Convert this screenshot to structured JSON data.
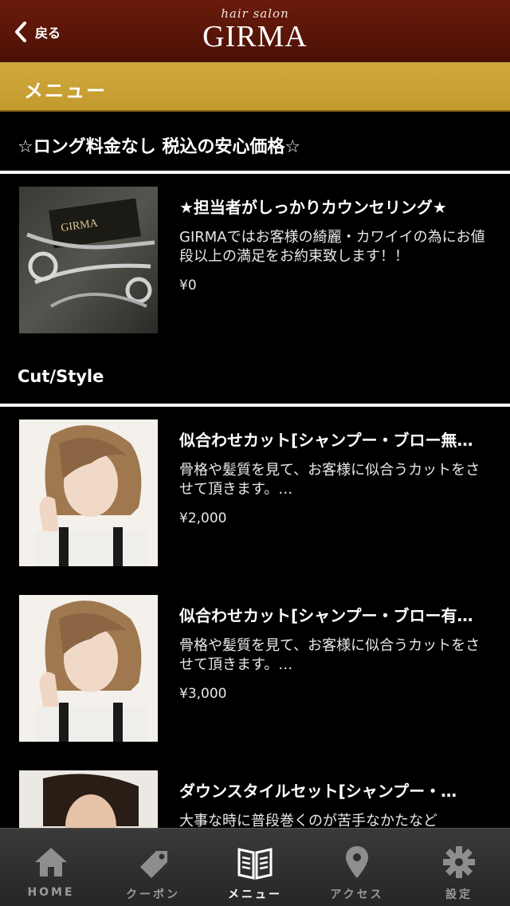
{
  "header": {
    "back_label": "戻る",
    "brand_sub": "hair salon",
    "brand_main": "GIRMA"
  },
  "section": {
    "title": "メニュー"
  },
  "categories": [
    {
      "title": "☆ロング料金なし 税込の安心価格☆",
      "items": [
        {
          "title": "★担当者がしっかりカウンセリング★",
          "desc": "GIRMAではお客様の綺麗・カワイイの為にお値段以上の満足をお約束致します！！",
          "price": "¥0"
        }
      ]
    },
    {
      "title": "Cut/Style",
      "items": [
        {
          "title": "似合わせカット[シャンプー・ブロー無…",
          "desc": "骨格や髪質を見て、お客様に似合うカットをさせて頂きます。…",
          "price": "¥2,000"
        },
        {
          "title": "似合わせカット[シャンプー・ブロー有…",
          "desc": "骨格や髪質を見て、お客様に似合うカットをさせて頂きます。…",
          "price": "¥3,000"
        },
        {
          "title": "ダウンスタイルセット[シャンプー・…",
          "desc": "大事な時に普段巻くのが苦手なかたなど",
          "price": ""
        }
      ]
    }
  ],
  "tabs": [
    {
      "label": "HOME",
      "icon": "home-icon"
    },
    {
      "label": "クーポン",
      "icon": "tag-icon"
    },
    {
      "label": "メニュー",
      "icon": "book-icon",
      "active": true
    },
    {
      "label": "アクセス",
      "icon": "map-pin-icon"
    },
    {
      "label": "設定",
      "icon": "gear-icon"
    }
  ],
  "colors": {
    "header": "#5a1508",
    "section_bar": "#c9a033",
    "tabbar": "#2e2e2e"
  }
}
